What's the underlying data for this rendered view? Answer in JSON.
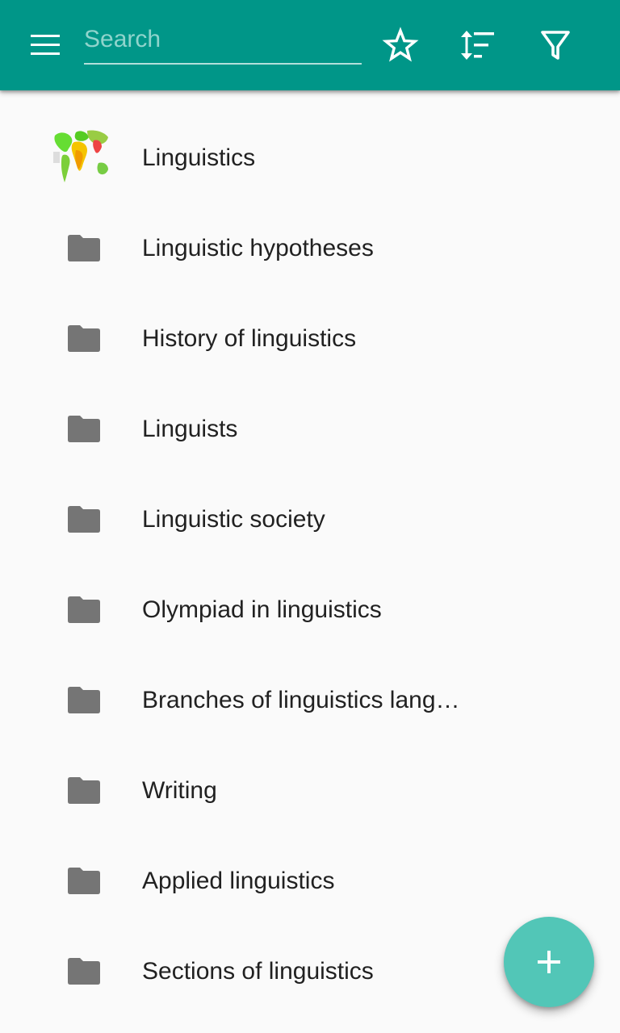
{
  "appbar": {
    "color": "#009688",
    "menu_icon": "hamburger-menu-icon",
    "search": {
      "placeholder": "Search",
      "value": ""
    },
    "actions": [
      {
        "name": "favorites",
        "icon": "star-outline-icon"
      },
      {
        "name": "sort",
        "icon": "sort-icon"
      },
      {
        "name": "filter",
        "icon": "filter-icon"
      }
    ]
  },
  "list": {
    "items": [
      {
        "label": "Linguistics",
        "icon": "world-map-thumbnail"
      },
      {
        "label": "Linguistic hypotheses",
        "icon": "folder-icon"
      },
      {
        "label": "History of linguistics",
        "icon": "folder-icon"
      },
      {
        "label": "Linguists",
        "icon": "folder-icon"
      },
      {
        "label": "Linguistic society",
        "icon": "folder-icon"
      },
      {
        "label": "Olympiad in linguistics",
        "icon": "folder-icon"
      },
      {
        "label": "Branches of linguistics lang…",
        "icon": "folder-icon"
      },
      {
        "label": "Writing",
        "icon": "folder-icon"
      },
      {
        "label": "Applied linguistics",
        "icon": "folder-icon"
      },
      {
        "label": "Sections of linguistics",
        "icon": "folder-icon"
      }
    ]
  },
  "fab": {
    "icon": "plus-icon",
    "color": "#52c6b7"
  }
}
